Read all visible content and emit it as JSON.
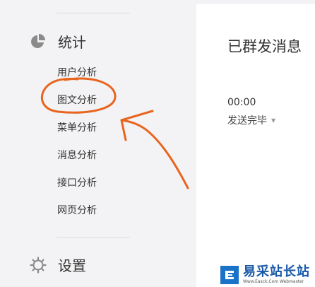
{
  "sidebar": {
    "stats": {
      "label": "统计",
      "icon": "pie-chart-icon",
      "items": [
        {
          "label": "用户分析"
        },
        {
          "label": "图文分析"
        },
        {
          "label": "菜单分析"
        },
        {
          "label": "消息分析"
        },
        {
          "label": "接口分析"
        },
        {
          "label": "网页分析"
        }
      ]
    },
    "settings": {
      "label": "设置",
      "icon": "gear-icon"
    }
  },
  "main": {
    "title": "已群发消息",
    "message": {
      "time": "00:00",
      "status": "发送完毕"
    }
  },
  "annotation": {
    "color": "#e8651f"
  },
  "watermark": {
    "title": "易采站长站",
    "url": "Www.Easck.Com  Webmaster"
  }
}
